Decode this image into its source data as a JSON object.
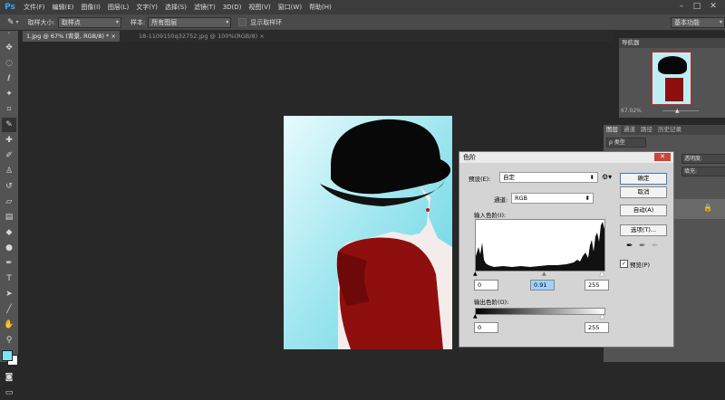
{
  "app": {
    "logo": "Ps"
  },
  "menu": [
    "文件(F)",
    "编辑(E)",
    "图像(I)",
    "图层(L)",
    "文字(Y)",
    "选择(S)",
    "滤镜(T)",
    "3D(D)",
    "视图(V)",
    "窗口(W)",
    "帮助(H)"
  ],
  "window_controls": {
    "minimize": "–",
    "restore": "□",
    "close": "✕"
  },
  "options": {
    "sample_size_label": "取样大小:",
    "sample_size_value": "取样点",
    "sample_label": "样本:",
    "sample_value": "所有图层",
    "show_ring_label": "显示取样环",
    "workspace": "基本功能"
  },
  "tabs": [
    {
      "label": "1.jpg @ 67% (背景, RGB/8) *",
      "active": true
    },
    {
      "label": "18-1109150q32752.jpg @ 100%(RGB/8)",
      "active": false
    }
  ],
  "navigator": {
    "title": "导航器",
    "zoom": "67.02%"
  },
  "layers": {
    "tabs": [
      "图层",
      "通道",
      "路径",
      "历史记录"
    ],
    "kind_label": "ρ 类型",
    "opacity_label": "透明度:",
    "fill_label": "填充:"
  },
  "levels": {
    "title": "色阶",
    "preset_label": "预设(E):",
    "preset_value": "自定",
    "channel_label": "通道:",
    "channel_value": "RGB",
    "input_levels_label": "输入色阶(I):",
    "input_black": "0",
    "input_gamma": "0.91",
    "input_white": "255",
    "output_levels_label": "输出色阶(O):",
    "output_black": "0",
    "output_white": "255",
    "buttons": {
      "ok": "确定",
      "cancel": "取消",
      "auto": "自动(A)",
      "options": "选项(T)..."
    },
    "preview_label": "预览(P)",
    "preview_checked": true
  },
  "colors": {
    "foreground": "#7ee3f2",
    "background": "#ffffff",
    "accent": "#31a8ff"
  }
}
